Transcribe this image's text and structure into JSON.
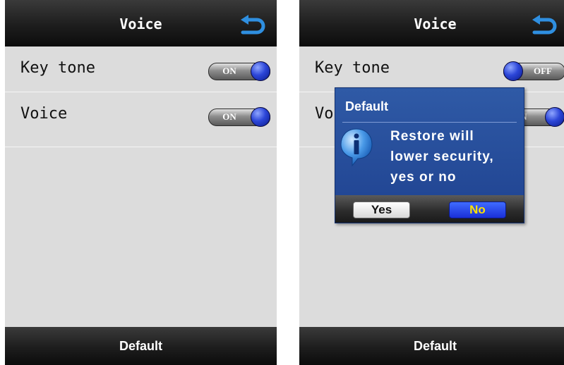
{
  "screens": [
    {
      "title": "Voice",
      "settings": [
        {
          "label": "Key tone",
          "toggle": "ON"
        },
        {
          "label": "Voice",
          "toggle": "ON"
        }
      ],
      "bottom_button": "Default"
    },
    {
      "title": "Voice",
      "settings": [
        {
          "label": "Key tone",
          "toggle": "OFF"
        },
        {
          "label": "Vo",
          "toggle": "N"
        }
      ],
      "bottom_button": "Default",
      "dialog": {
        "title": "Default",
        "message_lines": [
          "Restore will",
          "lower security,",
          "yes or no"
        ],
        "yes_label": "Yes",
        "no_label": "No"
      }
    }
  ],
  "colors": {
    "bar_dark": "#1d1d1d",
    "screen_bg": "#dcdcdc",
    "toggle_knob": "#2c46d8",
    "dialog_bg": "#2f5aa6",
    "back_arrow": "#2f8fe0",
    "no_text": "#ffe100"
  },
  "icons": {
    "back": "back-arrow-icon",
    "dialog": "info-bubble-icon"
  }
}
